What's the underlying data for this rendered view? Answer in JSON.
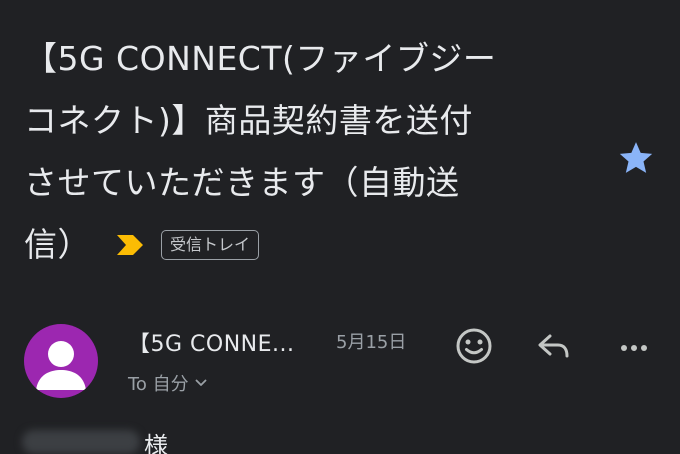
{
  "subject": {
    "line1": "【5G CONNECT(ファイブジー",
    "line2": "コネクト)】商品契約書を送付",
    "line3": "させていただきます（自動送",
    "line4": "信）",
    "label": "受信トレイ",
    "importance_icon": "important-marker",
    "importance_color": "#fbbc04",
    "starred": true,
    "star_color": "#8ab4f8"
  },
  "sender": {
    "avatar_color": "#9c27b0",
    "name": "【5G CONNE...",
    "date": "5月15日",
    "recipient": "To 自分"
  },
  "actions": {
    "emoji_icon": "emoji-reaction-icon",
    "reply_icon": "reply-icon",
    "more_icon": "more-options-icon"
  },
  "body": {
    "honorific": "様"
  }
}
